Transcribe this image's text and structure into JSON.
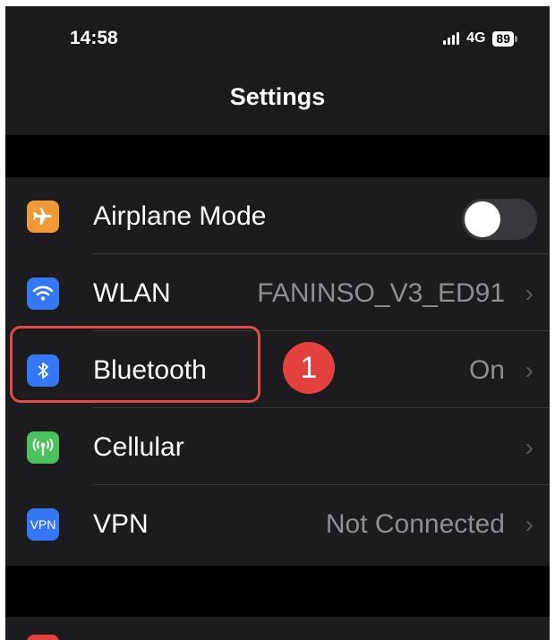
{
  "status_bar": {
    "time": "14:58",
    "network": "4G",
    "battery": "89"
  },
  "header": {
    "title": "Settings"
  },
  "settings": {
    "items": [
      {
        "label": "Airplane Mode",
        "icon": "airplane-icon",
        "icon_color": "#f09a37",
        "toggle_on": false
      },
      {
        "label": "WLAN",
        "value": "FANINSO_V3_ED91",
        "icon": "wifi-icon",
        "icon_color": "#3478f6"
      },
      {
        "label": "Bluetooth",
        "value": "On",
        "icon": "bluetooth-icon",
        "icon_color": "#3478f6"
      },
      {
        "label": "Cellular",
        "value": "",
        "icon": "antenna-icon",
        "icon_color": "#4cc25e"
      },
      {
        "label": "VPN",
        "value": "Not Connected",
        "icon": "vpn-icon",
        "icon_text": "VPN",
        "icon_color": "#3478f6"
      }
    ]
  },
  "annotation": {
    "step_number": "1",
    "color": "#e2413d"
  },
  "chevron": "›"
}
